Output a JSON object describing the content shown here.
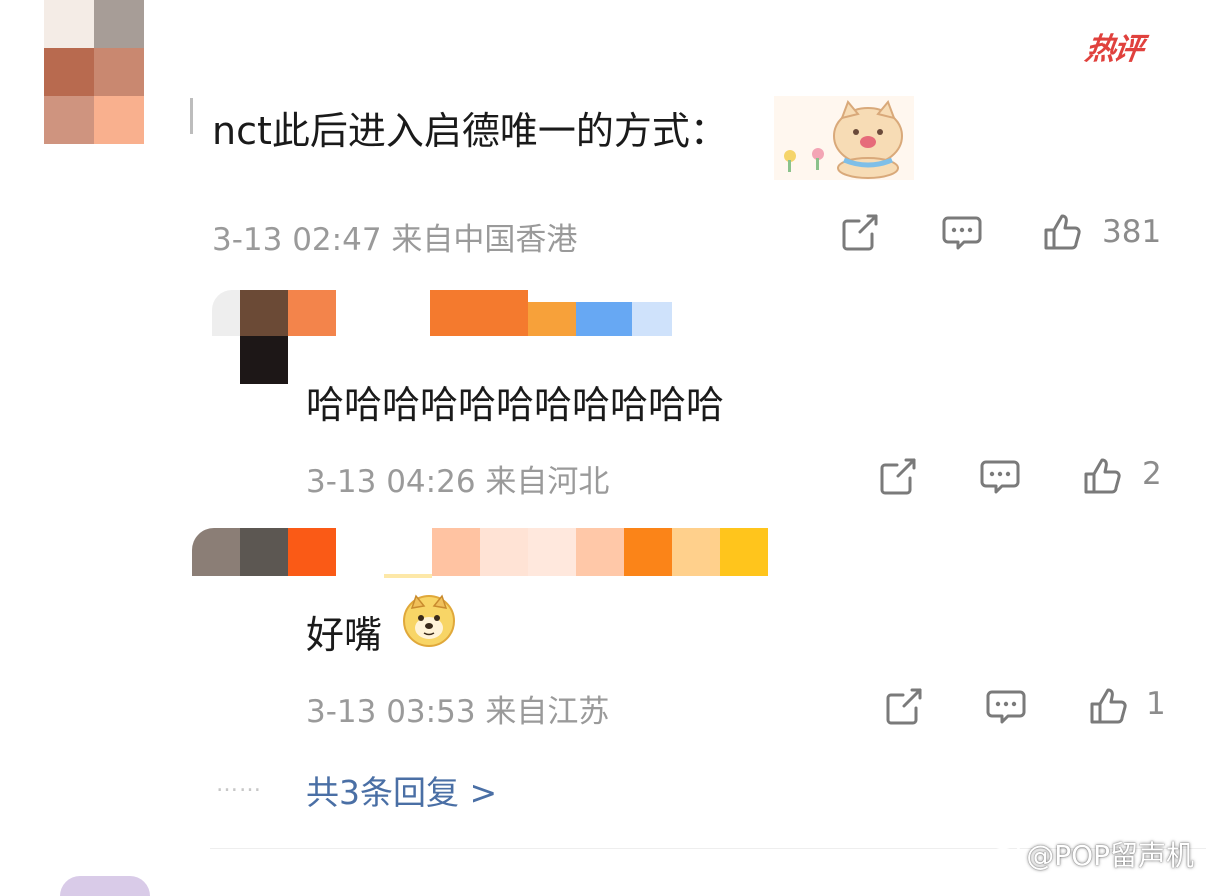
{
  "comment": {
    "hot_badge": "热评",
    "text": "nct此后进入启德唯一的方式：",
    "meta": "3-13 02:47 来自中国香港",
    "like_count": "381"
  },
  "replies": [
    {
      "text": "哈哈哈哈哈哈哈哈哈哈哈",
      "meta": "3-13 04:26 来自河北",
      "like_count": "2"
    },
    {
      "text": "好嘴",
      "meta": "3-13 03:53 来自江苏",
      "like_count": "1"
    }
  ],
  "more_replies": "共3条回复 >",
  "dots": "……",
  "watermark": "@POP留声机",
  "icons": {
    "share": "share-icon",
    "comment": "comment-icon",
    "like": "thumbs-up-icon",
    "sticker_cat": "cat-sticker-icon",
    "doge": "doge-emoji-icon",
    "weibo": "weibo-logo-icon"
  },
  "colors": {
    "hot_badge": "#e0413d",
    "link": "#4a6fa5",
    "meta": "#9a9a9a"
  }
}
